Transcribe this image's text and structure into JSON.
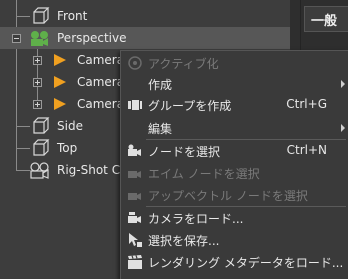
{
  "outliner": {
    "items": [
      {
        "label": "Front"
      },
      {
        "label": "Perspective"
      },
      {
        "label": "Camera T"
      },
      {
        "label": "Camera T"
      },
      {
        "label": "Camera T"
      },
      {
        "label": "Side"
      },
      {
        "label": "Top"
      },
      {
        "label": "Rig-Shot Car"
      }
    ]
  },
  "right_panel": {
    "tab_label": "一般"
  },
  "context_menu": {
    "items": [
      {
        "label": "アクティブ化",
        "disabled": true
      },
      {
        "label": "作成",
        "submenu": true
      },
      {
        "label": "グループを作成",
        "shortcut": "Ctrl+G"
      },
      {
        "label": "編集",
        "submenu": true
      },
      {
        "label": "ノードを選択",
        "shortcut": "Ctrl+N"
      },
      {
        "label": "エイム ノードを選択",
        "disabled": true
      },
      {
        "label": "アップベクトル ノードを選択",
        "disabled": true
      },
      {
        "label": "カメラをロード..."
      },
      {
        "label": "選択を保存..."
      },
      {
        "label": "レンダリング メタデータをロード..."
      }
    ]
  },
  "colors": {
    "background": "#3d3d3d",
    "menu": "#3a3a3a",
    "camera_orange": "#f0a020",
    "group_green": "#5fb04a",
    "disabled_text": "#7a7a7a"
  }
}
